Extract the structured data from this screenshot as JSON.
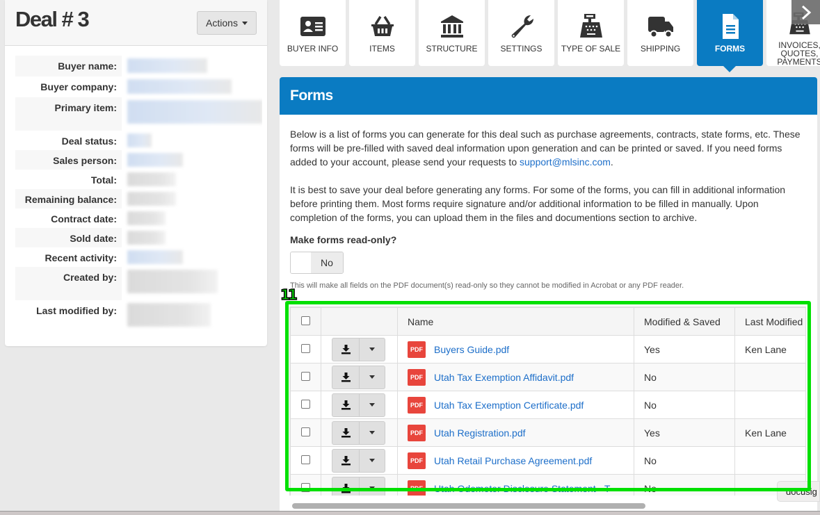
{
  "deal": {
    "title": "Deal # 3",
    "actions_label": "Actions"
  },
  "info_fields": [
    {
      "label": "Buyer name:",
      "value": "[redacted]"
    },
    {
      "label": "Buyer company:",
      "value": "[redacted]"
    },
    {
      "label": "Primary item:",
      "value": "[redacted]"
    },
    {
      "label": "Deal status:",
      "value": "[redacted]"
    },
    {
      "label": "Sales person:",
      "value": "[redacted]"
    },
    {
      "label": "Total:",
      "value": "[redacted]"
    },
    {
      "label": "Remaining balance:",
      "value": "[redacted]"
    },
    {
      "label": "Contract date:",
      "value": "[redacted]"
    },
    {
      "label": "Sold date:",
      "value": "[redacted]"
    },
    {
      "label": "Recent activity:",
      "value": "[redacted]"
    },
    {
      "label": "Created by:",
      "value": "[redacted]"
    },
    {
      "label": "Last modified by:",
      "value": "[redacted]"
    }
  ],
  "tabs": [
    {
      "label": "BUYER INFO",
      "icon": "id-card-icon"
    },
    {
      "label": "ITEMS",
      "icon": "basket-icon"
    },
    {
      "label": "STRUCTURE",
      "icon": "bank-icon"
    },
    {
      "label": "SETTINGS",
      "icon": "wrench-icon"
    },
    {
      "label": "TYPE OF SALE",
      "icon": "cash-register-icon"
    },
    {
      "label": "SHIPPING",
      "icon": "truck-icon"
    },
    {
      "label": "FORMS",
      "icon": "document-icon",
      "active": true
    },
    {
      "label": "INVOICES, QUOTES, PAYMENTS",
      "icon": "cash-register-icon"
    }
  ],
  "panel": {
    "title": "Forms",
    "intro_1": "Below is a list of forms you can generate for this deal such as purchase agreements, contracts, state forms, etc. These forms will be pre-filled with saved deal information upon generation and can be printed or saved. If you need forms added to your account, please send your requests to ",
    "support_email": "support@mlsinc.com",
    "intro_1_end": ".",
    "intro_2": "It is best to save your deal before generating any forms. For some of the forms, you can fill in additional information before printing them. Most forms require signature and/or additional information to be filled in manually. Upon completion of the forms, you can upload them in the files and documentions section to archive.",
    "readonly_label": "Make forms read-only?",
    "readonly_value": "No",
    "readonly_help": "This will make all fields on the PDF document(s) read-only so they cannot be modified in Acrobat or any PDF reader."
  },
  "table": {
    "columns": [
      "",
      "",
      "Name",
      "Modified & Saved",
      "Last Modified By"
    ],
    "pdf_badge": "PDF",
    "rows": [
      {
        "name": "Buyers Guide.pdf",
        "modified": "Yes",
        "last_by": "Ken Lane"
      },
      {
        "name": "Utah Tax Exemption Affidavit.pdf",
        "modified": "No",
        "last_by": ""
      },
      {
        "name": "Utah Tax Exemption Certificate.pdf",
        "modified": "No",
        "last_by": ""
      },
      {
        "name": "Utah Registration.pdf",
        "modified": "Yes",
        "last_by": "Ken Lane"
      },
      {
        "name": "Utah Retail Purchase Agreement.pdf",
        "modified": "No",
        "last_by": ""
      },
      {
        "name": "Utah Odometer Disclosure Statement - T",
        "modified": "No",
        "last_by": ""
      }
    ]
  },
  "docusign_label": "docusig",
  "annotation": {
    "label": "11",
    "color": "#00e000"
  },
  "colors": {
    "accent": "#0a7bc2",
    "link": "#1c6ec9",
    "pdf": "#e8453c"
  }
}
